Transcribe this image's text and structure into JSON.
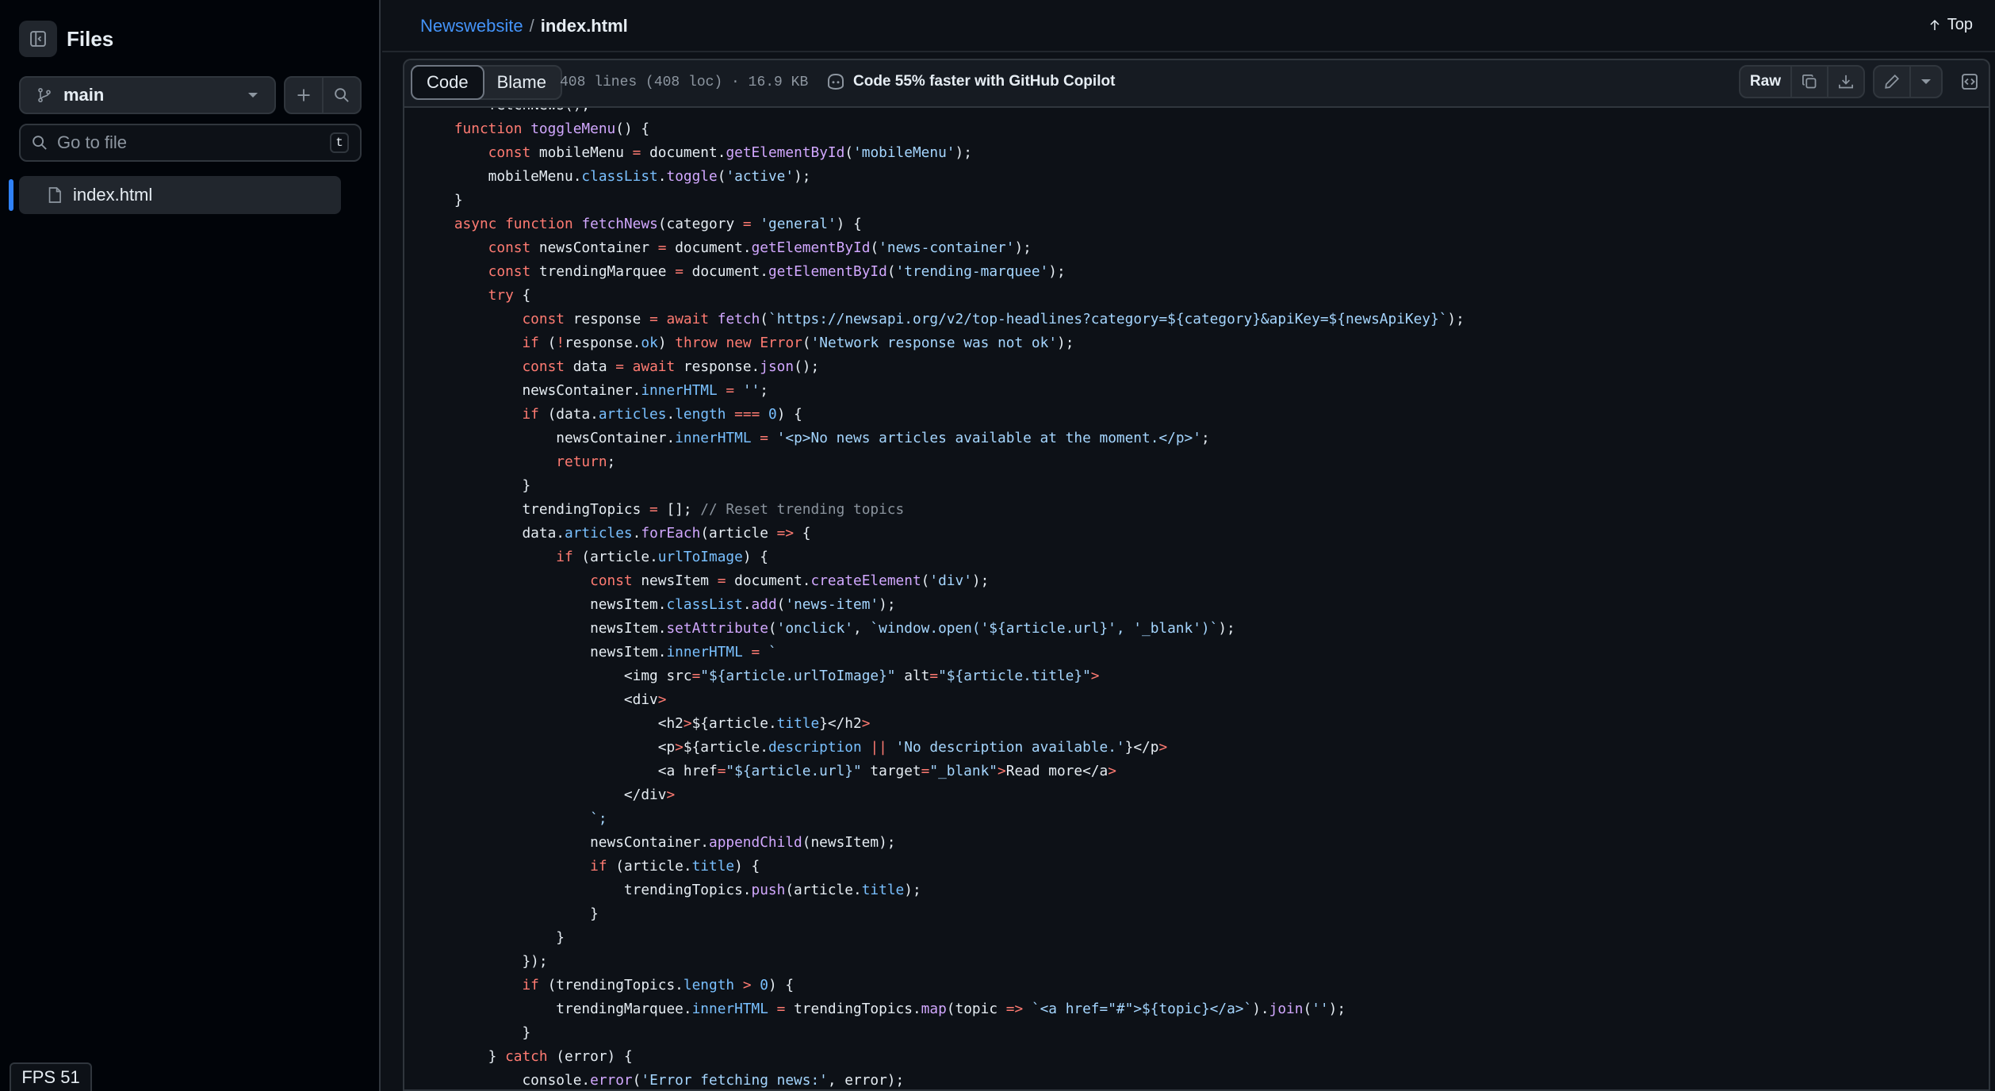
{
  "sidebar": {
    "title": "Files",
    "branch": "main",
    "go_to_file_placeholder": "Go to file",
    "go_to_file_shortcut": "t",
    "files": [
      {
        "name": "index.html"
      }
    ]
  },
  "header": {
    "repo": "Newswebsite",
    "separator": "/",
    "file": "index.html",
    "top_label": "Top"
  },
  "file_toolbar": {
    "tab_code": "Code",
    "tab_blame": "Blame",
    "meta": "408 lines (408 loc) · 16.9 KB",
    "copilot": "Code 55% faster with GitHub Copilot",
    "raw_label": "Raw"
  },
  "code_lines": [
    "        fetchNews();",
    "    function toggleMenu() {",
    "        const mobileMenu = document.getElementById('mobileMenu');",
    "        mobileMenu.classList.toggle('active');",
    "    }",
    "    async function fetchNews(category = 'general') {",
    "        const newsContainer = document.getElementById('news-container');",
    "        const trendingMarquee = document.getElementById('trending-marquee');",
    "        try {",
    "            const response = await fetch(`https://newsapi.org/v2/top-headlines?category=${category}&apiKey=${newsApiKey}`);",
    "            if (!response.ok) throw new Error('Network response was not ok');",
    "            const data = await response.json();",
    "            newsContainer.innerHTML = '';",
    "            if (data.articles.length === 0) {",
    "                newsContainer.innerHTML = '<p>No news articles available at the moment.</p>';",
    "                return;",
    "            }",
    "            trendingTopics = []; // Reset trending topics",
    "            data.articles.forEach(article => {",
    "                if (article.urlToImage) {",
    "                    const newsItem = document.createElement('div');",
    "                    newsItem.classList.add('news-item');",
    "                    newsItem.setAttribute('onclick', `window.open('${article.url}', '_blank')`);",
    "                    newsItem.innerHTML = `",
    "                        <img src=\"${article.urlToImage}\" alt=\"${article.title}\">",
    "                        <div>",
    "                            <h2>${article.title}</h2>",
    "                            <p>${article.description || 'No description available.'}</p>",
    "                            <a href=\"${article.url}\" target=\"_blank\">Read more</a>",
    "                        </div>",
    "                    `;",
    "                    newsContainer.appendChild(newsItem);",
    "                    if (article.title) {",
    "                        trendingTopics.push(article.title);",
    "                    }",
    "                }",
    "            });",
    "            if (trendingTopics.length > 0) {",
    "                trendingMarquee.innerHTML = trendingTopics.map(topic => `<a href=\"#\">${topic}</a>`).join('');",
    "            }",
    "        } catch (error) {",
    "            console.error('Error fetching news:', error);"
  ],
  "fps": "FPS 51",
  "colors": {
    "bg": "#0d1117",
    "sidebar_bg": "#010409",
    "link": "#4493f8",
    "keyword": "#ff7b72",
    "function": "#d2a8ff",
    "string": "#a5d6ff",
    "property": "#79c0ff",
    "comment": "#8b949e"
  }
}
